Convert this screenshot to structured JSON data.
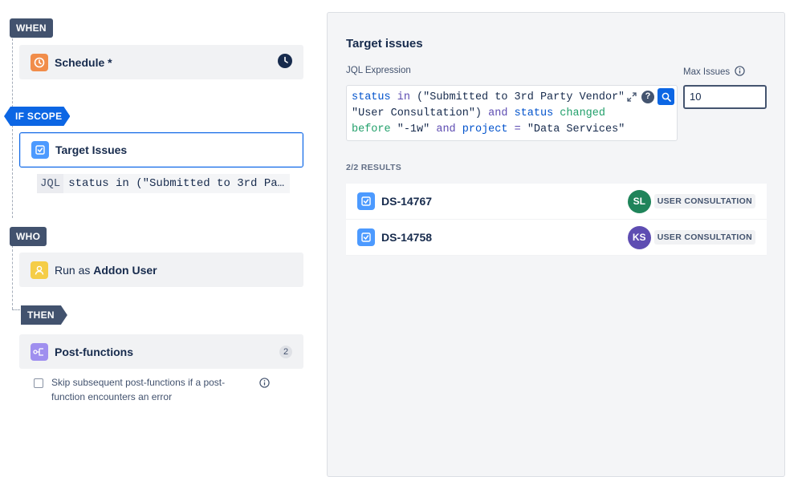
{
  "flow": {
    "when_tag": "WHEN",
    "schedule_title": "Schedule *",
    "scope_tag": "IF SCOPE",
    "target_title": "Target Issues",
    "jql_label": "JQL",
    "jql_preview": "status in (\"Submitted to 3rd Party Vendor\", \"User Consultation\") and status changed before \"-1w\" and project = \"Data Services\"",
    "who_tag": "WHO",
    "run_as_prefix": "Run as ",
    "run_as_user": "Addon User",
    "then_tag": "THEN",
    "postfunctions_title": "Post-functions",
    "postfunctions_count": "2",
    "skip_label": "Skip subsequent post-functions if a post-function encounters an error"
  },
  "panel": {
    "title": "Target issues",
    "jql_expression_label": "JQL Expression",
    "max_issues_label": "Max Issues",
    "max_issues_value": "10",
    "jql": {
      "t1": "status",
      "t2": "in",
      "t3": "(\"Submitted to 3rd Party Vendor\",",
      "t4": "\"User Consultation\")",
      "t5": "and",
      "t6": "status",
      "t7": "changed",
      "t8": "before",
      "t9": "\"-1w\"",
      "t10": "and",
      "t11": "project",
      "t12": "=",
      "t13": "\"Data Services\""
    },
    "results_label": "2/2 RESULTS",
    "results": [
      {
        "key": "DS-14767",
        "avatar": "SL",
        "avatar_color": "#1f845a",
        "status": "USER CONSULTATION"
      },
      {
        "key": "DS-14758",
        "avatar": "KS",
        "avatar_color": "#5e4db2",
        "status": "USER CONSULTATION"
      }
    ]
  },
  "colors": {
    "accent": "#0c66e4",
    "tag_dark": "#42526e",
    "schedule_icon": "#f18d4a",
    "postfunction_icon": "#9f8fef",
    "user_icon": "#f5cd47",
    "issue_icon": "#4c9aff"
  },
  "icons": [
    "clock-icon",
    "schedule-icon",
    "checkbox-issue-icon",
    "user-icon",
    "postfunction-icon",
    "info-icon",
    "expand-icon",
    "help-icon",
    "search-icon"
  ]
}
